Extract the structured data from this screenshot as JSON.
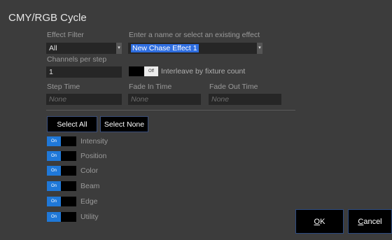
{
  "window": {
    "title": "CMY/RGB Cycle"
  },
  "effect_filter": {
    "label": "Effect Filter",
    "value": "All"
  },
  "effect_name": {
    "label": "Enter a name or select an existing effect",
    "value": "New Chase Effect 1"
  },
  "channels_per_step": {
    "label": "Channels per step",
    "value": "1"
  },
  "interleave": {
    "toggle_text": "Off",
    "label": "Interleave by fixture count",
    "state": "off"
  },
  "timing": {
    "step_time": {
      "label": "Step Time",
      "placeholder": "None"
    },
    "fade_in_time": {
      "label": "Fade In Time",
      "placeholder": "None"
    },
    "fade_out_time": {
      "label": "Fade Out Time",
      "placeholder": "None"
    }
  },
  "buttons": {
    "select_all": "Select All",
    "select_none": "Select None"
  },
  "categories": [
    {
      "label": "Intensity",
      "toggle_text": "On",
      "state": "on"
    },
    {
      "label": "Position",
      "toggle_text": "On",
      "state": "on"
    },
    {
      "label": "Color",
      "toggle_text": "On",
      "state": "on"
    },
    {
      "label": "Beam",
      "toggle_text": "On",
      "state": "on"
    },
    {
      "label": "Edge",
      "toggle_text": "On",
      "state": "on"
    },
    {
      "label": "Utility",
      "toggle_text": "On",
      "state": "on"
    }
  ],
  "dialog": {
    "ok_mnemonic": "O",
    "ok_rest": "K",
    "cancel_mnemonic": "C",
    "cancel_rest": "ancel"
  },
  "colors": {
    "background": "#3c3c3c",
    "accent": "#1f78d8",
    "selection": "#2f6ee0"
  }
}
